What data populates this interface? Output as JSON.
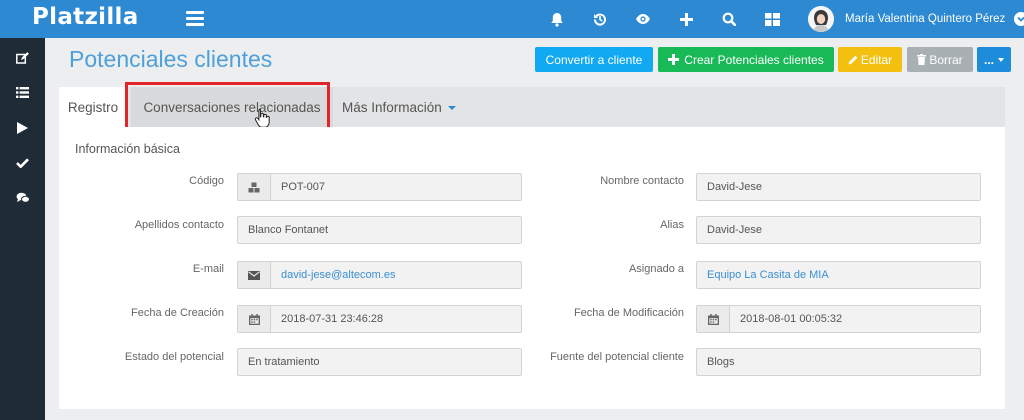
{
  "app": {
    "brand": "Platzilla"
  },
  "user": {
    "name": "María Valentina Quintero Pérez"
  },
  "header": {
    "title": "Potenciales clientes",
    "buttons": {
      "convert": "Convertir a cliente",
      "create": "Crear Potenciales clientes",
      "edit": "Editar",
      "delete": "Borrar",
      "more": "..."
    }
  },
  "tabs": {
    "registro": "Registro",
    "conversaciones": "Conversaciones relacionadas",
    "mas": "Más Información"
  },
  "section": {
    "title": "Información básica"
  },
  "fields": {
    "codigo": {
      "label": "Código",
      "value": "POT-007"
    },
    "nombre": {
      "label": "Nombre contacto",
      "value": "David-Jese"
    },
    "apellidos": {
      "label": "Apellidos contacto",
      "value": "Blanco Fontanet"
    },
    "alias": {
      "label": "Alias",
      "value": "David-Jese"
    },
    "email": {
      "label": "E-mail",
      "value": "david-jese@altecom.es"
    },
    "asignado": {
      "label": "Asignado a",
      "value": "Equipo La Casita de MIA"
    },
    "fecha_creacion": {
      "label": "Fecha de Creación",
      "value": "2018-07-31 23:46:28"
    },
    "fecha_mod": {
      "label": "Fecha de Modificación",
      "value": "2018-08-01 00:05:32"
    },
    "estado": {
      "label": "Estado del potencial",
      "value": "En tratamiento"
    },
    "fuente": {
      "label": "Fuente del potencial cliente",
      "value": "Blogs"
    }
  },
  "colors": {
    "topbar": "#2d89d1",
    "sidebar": "#1f2c38",
    "title": "#4fa0d8",
    "highlight": "#e0262c",
    "link": "#3a8fd1"
  }
}
